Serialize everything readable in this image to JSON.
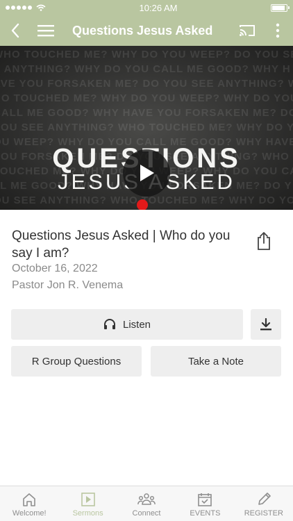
{
  "status_bar": {
    "time": "10:26 AM",
    "battery_level": 0.95
  },
  "header": {
    "title": "Questions Jesus Asked",
    "icons": [
      "back-icon",
      "menu-icon",
      "cast-icon",
      "more-vertical-icon"
    ]
  },
  "hero": {
    "title_line1": "QUESTIONS",
    "title_line2": "JESUS ASKED",
    "background_text": "WHO TOUCHED ME? WHY DO YOU WEEP? DO YOU SEE ANYTHING? WHY DO YOU CALL ME GOOD? WHY HAVE YOU FORSAKEN ME? DO YOU SEE ANYTHING? WHO TOUCHED ME? WHY DO YOU WEEP? WHY DO YOU CALL ME GOOD? WHY HAVE YOU FORSAKEN ME? DO YOU SEE ANYTHING? WHO TOUCHED ME? WHY DO YOU WEEP? WHY DO YOU CALL ME GOOD? WHY HAVE YOU FORSAKEN ME? DO YOU SEE ANYTHING? WHO TOUCHED ME? WHY DO YOU WEEP? WHY DO YOU CALL ME GOOD? WHY HAVE YOU FORSAKEN ME? DO YOU SEE ANYTHING? WHO TOUCHED ME? WHY DO YOU WEEP? WHY DO YOU CALL ME GOOD? WHY HAVE YOU FORSAKEN ME? DO YOU SEE ANYTHING? WHO TOUCHED ME? WHY DO YOU WEEP? WHY DO YOU CALL ME GOOD? WHY HAVE YOU FORSAKEN ME? DO YOU SEE ANYTHING?"
  },
  "sermon": {
    "title": "Questions Jesus Asked | Who do you say I am?",
    "date": "October 16, 2022",
    "speaker": "Pastor Jon R. Venema"
  },
  "actions": {
    "listen_label": "Listen",
    "rgroup_label": "R Group Questions",
    "note_label": "Take a Note"
  },
  "tabs": [
    {
      "label": "Welcome!",
      "icon": "home-icon",
      "active": false
    },
    {
      "label": "Sermons",
      "icon": "play-square-icon",
      "active": true
    },
    {
      "label": "Connect",
      "icon": "people-icon",
      "active": false
    },
    {
      "label": "EVENTS",
      "icon": "calendar-icon",
      "active": false
    },
    {
      "label": "REGISTER",
      "icon": "pencil-icon",
      "active": false
    }
  ],
  "colors": {
    "accent": "#b9c6a0",
    "play_dot": "#e21a1a",
    "button_bg": "#eeeeee"
  }
}
